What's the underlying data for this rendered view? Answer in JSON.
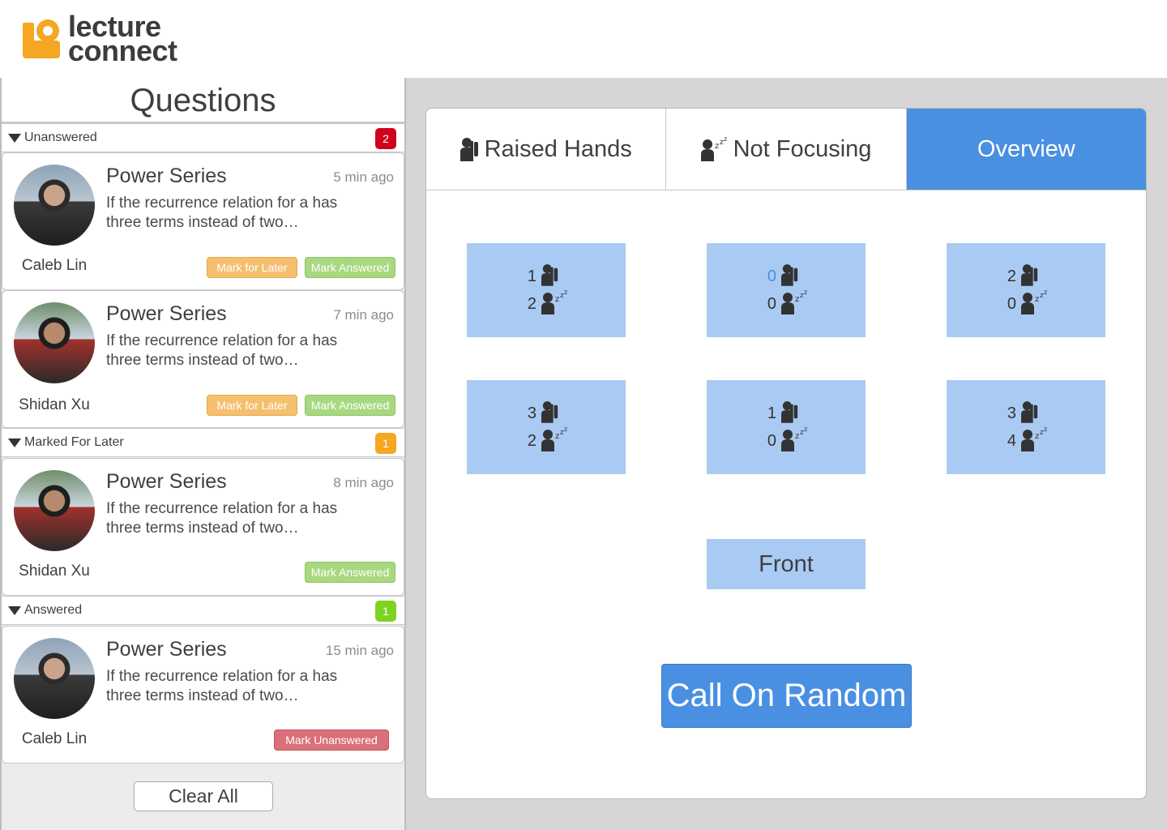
{
  "app": {
    "logo_line1": "lecture",
    "logo_line2": "connect",
    "accent_color": "#4a90e2",
    "logo_color": "#f5a623"
  },
  "questions": {
    "title": "Questions",
    "clear_label": "Clear All",
    "sections": [
      {
        "label": "Unanswered",
        "count": "2",
        "badge_color": "#d0021b",
        "cards": [
          {
            "title": "Power Series",
            "time": "5 min ago",
            "body": "If the recurrence relation for a has three terms instead of two…",
            "author": "Caleb Lin",
            "later_label": "Mark for Later",
            "answered_label": "Mark Answered"
          },
          {
            "title": "Power Series",
            "time": "7 min ago",
            "body": "If the recurrence relation for a has three terms instead of two…",
            "author": "Shidan Xu",
            "later_label": "Mark for Later",
            "answered_label": "Mark Answered"
          }
        ]
      },
      {
        "label": "Marked For Later",
        "count": "1",
        "badge_color": "#f5a623",
        "cards": [
          {
            "title": "Power Series",
            "time": "8 min ago",
            "body": "If the recurrence relation for a has three terms instead of two…",
            "author": "Shidan Xu",
            "answered_label": "Mark Answered"
          }
        ]
      },
      {
        "label": "Answered",
        "count": "1",
        "badge_color": "#7ed321",
        "cards": [
          {
            "title": "Power Series",
            "time": "15 min ago",
            "body": "If the recurrence relation for a has three terms instead of two…",
            "author": "Caleb Lin",
            "unanswer_label": "Mark Unanswered"
          }
        ]
      }
    ]
  },
  "tabs": [
    {
      "label": "Raised Hands",
      "icon": "raised-hand-icon",
      "active": false
    },
    {
      "label": "Not Focusing",
      "icon": "sleeping-icon",
      "active": false
    },
    {
      "label": "Overview",
      "icon": "",
      "active": true
    }
  ],
  "seats": [
    {
      "raised": "1",
      "sleeping": "2"
    },
    {
      "raised": "0",
      "sleeping": "0"
    },
    {
      "raised": "2",
      "sleeping": "0"
    },
    {
      "raised": "3",
      "sleeping": "2"
    },
    {
      "raised": "1",
      "sleeping": "0"
    },
    {
      "raised": "3",
      "sleeping": "4"
    }
  ],
  "front_label": "Front",
  "call_label": "Call On Random"
}
